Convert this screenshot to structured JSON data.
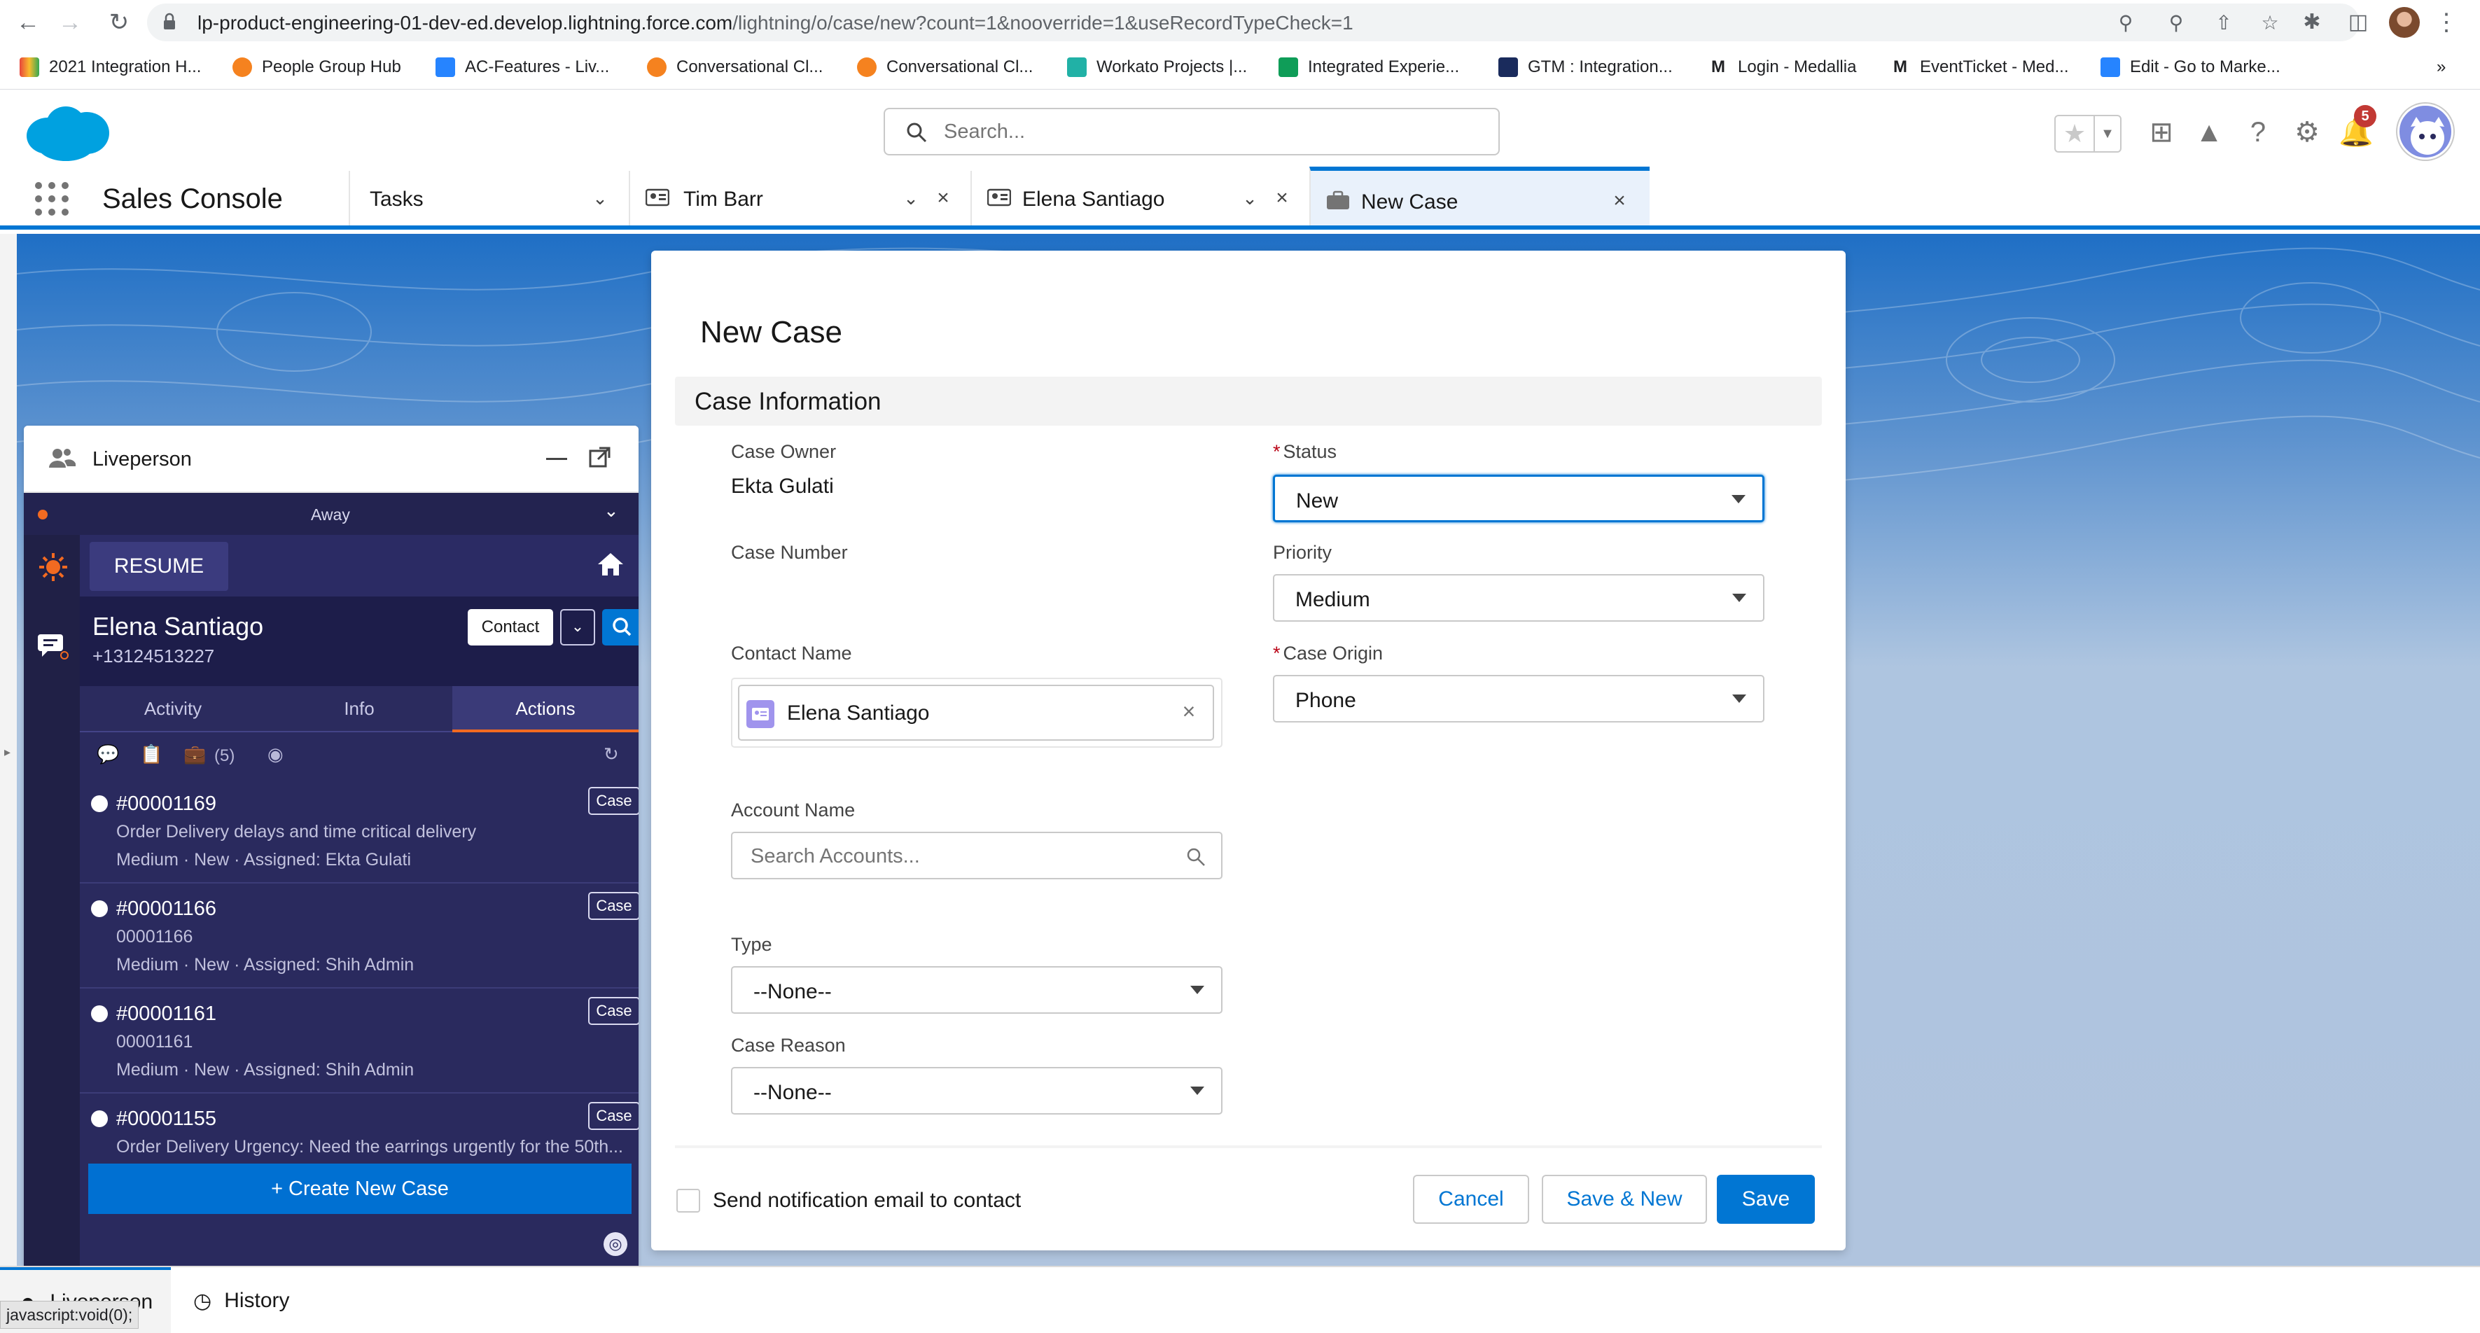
{
  "browser": {
    "url_host": "lp-product-engineering-01-dev-ed.develop.lightning.force.com",
    "url_path": "/lightning/o/case/new?count=1&nooverride=1&useRecordTypeCheck=1",
    "bookmarks": [
      "2021 Integration H...",
      "People Group Hub",
      "AC-Features - Liv...",
      "Conversational Cl...",
      "Conversational Cl...",
      "Workato Projects |...",
      "Integrated Experie...",
      "GTM : Integration...",
      "Login - Medallia",
      "EventTicket - Med...",
      "Edit - Go to Marke..."
    ],
    "status_text": "javascript:void(0);"
  },
  "header": {
    "search_placeholder": "Search...",
    "notification_count": "5"
  },
  "console_nav": {
    "app_name": "Sales Console",
    "nav_item": "Tasks",
    "tabs": [
      {
        "label": "Tim Barr"
      },
      {
        "label": "Elena Santiago"
      },
      {
        "label": "New Case"
      }
    ]
  },
  "liveperson": {
    "title": "Liveperson",
    "status": "Away",
    "resume_label": "RESUME",
    "contact_name": "Elena Santiago",
    "contact_phone": "+13124513227",
    "contact_button": "Contact",
    "tabs": [
      "Activity",
      "Info",
      "Actions"
    ],
    "case_count": "(5)",
    "case_button": "Case",
    "cases": [
      {
        "number": "#00001169",
        "description": "Order Delivery delays and time critical delivery",
        "meta": "Medium · New · Assigned: Ekta Gulati"
      },
      {
        "number": "#00001166",
        "description": "00001166",
        "meta": "Medium · New · Assigned: Shih Admin"
      },
      {
        "number": "#00001161",
        "description": "00001161",
        "meta": "Medium · New · Assigned: Shih Admin"
      },
      {
        "number": "#00001155",
        "description": "Order Delivery Urgency: Need the earrings urgently for the 50th...",
        "meta": ""
      }
    ],
    "create_label": "+ Create New Case"
  },
  "modal": {
    "title": "New Case",
    "section": "Case Information",
    "case_owner_label": "Case Owner",
    "case_owner_value": "Ekta Gulati",
    "case_number_label": "Case Number",
    "contact_name_label": "Contact Name",
    "contact_name_value": "Elena Santiago",
    "account_name_label": "Account Name",
    "account_placeholder": "Search Accounts...",
    "type_label": "Type",
    "type_value": "--None--",
    "case_reason_label": "Case Reason",
    "case_reason_value": "--None--",
    "status_label": "Status",
    "status_value": "New",
    "priority_label": "Priority",
    "priority_value": "Medium",
    "case_origin_label": "Case Origin",
    "case_origin_value": "Phone",
    "notify_label": "Send notification email to contact",
    "cancel_label": "Cancel",
    "save_new_label": "Save & New",
    "save_label": "Save"
  },
  "utility_bar": {
    "items": [
      "Liveperson",
      "History"
    ]
  },
  "colors": {
    "brand": "#0176d3",
    "lp_dark": "#2a2a5e",
    "required": "#ba0517"
  }
}
